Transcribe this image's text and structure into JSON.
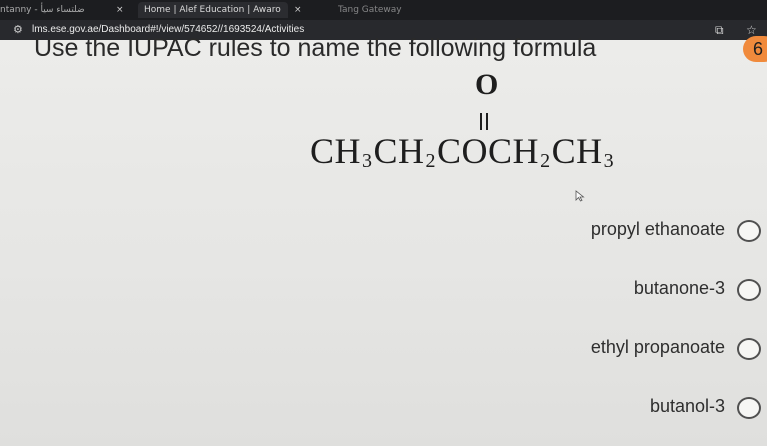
{
  "browser": {
    "tabs": [
      {
        "label": "ntanny - ضلتساء سيأ",
        "close": "×"
      },
      {
        "label": "Home | Alef Education | Awaro",
        "close": "×"
      },
      {
        "label": "Tang Gateway"
      },
      {
        "label": ""
      }
    ],
    "url": "lms.ese.gov.ae/Dashboard#!/view/574652//1693524/Activities",
    "icons": {
      "site_info": "tune-icon",
      "extensions": "extensions-icon",
      "bookmark": "star-icon"
    }
  },
  "question": {
    "text": "Use the IUPAC rules to name the following formula",
    "badge": "6"
  },
  "formula": {
    "top_atom": "O",
    "parts": [
      {
        "text": "CH",
        "sub": "3"
      },
      {
        "text": "CH",
        "sub": "2"
      },
      {
        "text": "COCH",
        "sub": "2"
      },
      {
        "text": "CH",
        "sub": "3"
      }
    ]
  },
  "options": [
    {
      "label": "propyl ethanoate",
      "selected": false
    },
    {
      "label": "butanone-3",
      "selected": false
    },
    {
      "label": "ethyl propanoate",
      "selected": false
    },
    {
      "label": "butanol-3",
      "selected": false
    }
  ]
}
